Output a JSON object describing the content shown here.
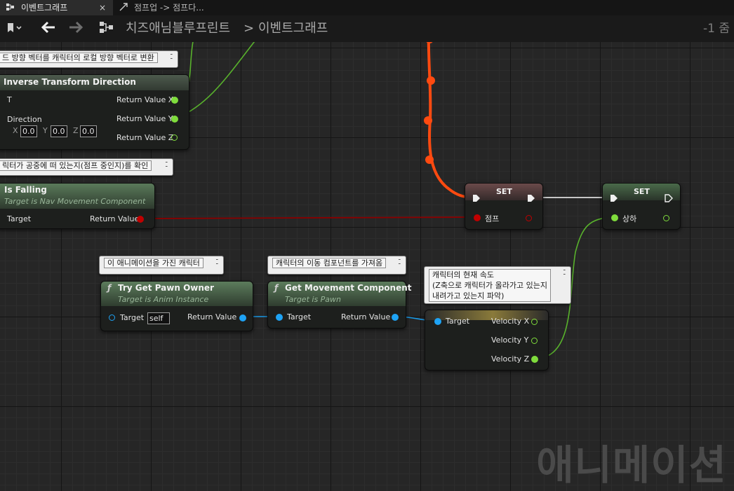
{
  "tabs": [
    {
      "label": "이벤트그래프",
      "icon": "event-graph-icon",
      "close": "×"
    },
    {
      "label": "점프업 -> 점프다...",
      "icon": "transition-icon"
    }
  ],
  "toolbar": {
    "breadcrumb": [
      "치즈애님블루프린트",
      "이벤트그래프"
    ],
    "separator": ">",
    "zoom": "-1 줌"
  },
  "comments": [
    {
      "text": "드 방향 벡터를 캐릭터의 로컬 방향 벡터로 변환"
    },
    {
      "text": "릭터가 공중에 떠 있는지(점프 중인지)를 확인"
    },
    {
      "text": "이 애니메이션을 가진 캐릭터"
    },
    {
      "text": "캐릭터의 이동 컴포넌트를 가져옴"
    },
    {
      "lines": [
        "캐릭터의 현재 속도",
        "(Z축으로 캐릭터가 올라가고 있는지",
        "내려가고 있는지 파악)"
      ]
    }
  ],
  "nodes": {
    "inverse_transform": {
      "title": "Inverse Transform Direction",
      "pins_in": [
        "T",
        "Direction"
      ],
      "vector": {
        "x_label": "X",
        "x": "0.0",
        "y_label": "Y",
        "y": "0.0",
        "z_label": "Z",
        "z": "0.0"
      },
      "pins_out": [
        "Return Value X",
        "Return Value Y",
        "Return Value Z"
      ]
    },
    "is_falling": {
      "title": "Is Falling",
      "subtitle": "Target is Nav Movement Component",
      "pin_in": "Target",
      "pin_out": "Return Value"
    },
    "try_get_pawn": {
      "title": "Try Get Pawn Owner",
      "subtitle": "Target is Anim Instance",
      "pin_in": "Target",
      "self_value": "self",
      "pin_out": "Return Value"
    },
    "get_movement": {
      "title": "Get Movement Component",
      "subtitle": "Target is Pawn",
      "pin_in": "Target",
      "pin_out": "Return Value"
    },
    "break_velocity": {
      "pin_in": "Target",
      "pins_out": [
        "Velocity X",
        "Velocity Y",
        "Velocity Z"
      ]
    },
    "set_jump": {
      "title": "SET",
      "pin": "점프"
    },
    "set_updown": {
      "title": "SET",
      "pin": "상하"
    }
  },
  "watermark": "애니메이션",
  "colors": {
    "exec_wire": "#ff4a10",
    "bool_wire": "#8a0000",
    "float_wire": "#58b12c",
    "object_wire": "#1b9be8",
    "bool_pin": "#c00000",
    "float_pin": "#7fdc3c",
    "object_pin": "#1ea3f5"
  }
}
